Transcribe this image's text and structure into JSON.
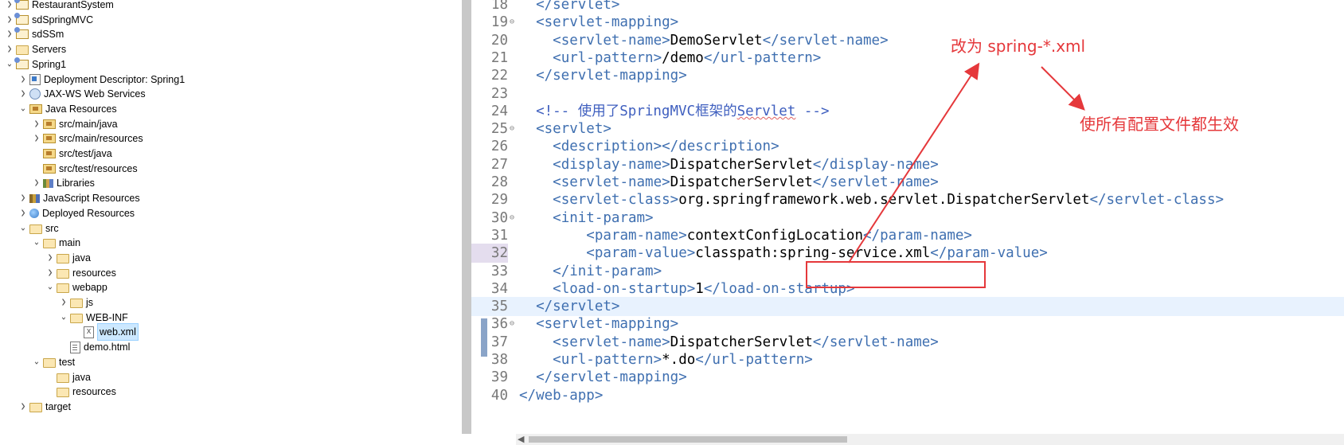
{
  "tree": {
    "items": [
      {
        "label": "RestaurantSystem",
        "chev": ">",
        "icon": "project",
        "depth": 0
      },
      {
        "label": "sdSpringMVC",
        "chev": ">",
        "icon": "project",
        "depth": 0
      },
      {
        "label": "sdSSm",
        "chev": ">",
        "icon": "project",
        "depth": 0
      },
      {
        "label": "Servers",
        "chev": ">",
        "icon": "folder",
        "depth": 0
      },
      {
        "label": "Spring1",
        "chev": "v",
        "icon": "project",
        "depth": 0
      },
      {
        "label": "Deployment Descriptor: Spring1",
        "chev": ">",
        "icon": "desc",
        "depth": 1
      },
      {
        "label": "JAX-WS Web Services",
        "chev": ">",
        "icon": "ws",
        "depth": 1
      },
      {
        "label": "Java Resources",
        "chev": "v",
        "icon": "pkg",
        "depth": 1
      },
      {
        "label": "src/main/java",
        "chev": ">",
        "icon": "pkg",
        "depth": 2
      },
      {
        "label": "src/main/resources",
        "chev": ">",
        "icon": "pkg",
        "depth": 2
      },
      {
        "label": "src/test/java",
        "chev": "",
        "icon": "pkg",
        "depth": 2
      },
      {
        "label": "src/test/resources",
        "chev": "",
        "icon": "pkg",
        "depth": 2
      },
      {
        "label": "Libraries",
        "chev": ">",
        "icon": "lib",
        "depth": 2
      },
      {
        "label": "JavaScript Resources",
        "chev": ">",
        "icon": "jsres",
        "depth": 1
      },
      {
        "label": "Deployed Resources",
        "chev": ">",
        "icon": "globe",
        "depth": 1
      },
      {
        "label": "src",
        "chev": "v",
        "icon": "folder",
        "depth": 1
      },
      {
        "label": "main",
        "chev": "v",
        "icon": "folder",
        "depth": 2
      },
      {
        "label": "java",
        "chev": ">",
        "icon": "folder",
        "depth": 3
      },
      {
        "label": "resources",
        "chev": ">",
        "icon": "folder",
        "depth": 3
      },
      {
        "label": "webapp",
        "chev": "v",
        "icon": "folder",
        "depth": 3
      },
      {
        "label": "js",
        "chev": ">",
        "icon": "folder",
        "depth": 4
      },
      {
        "label": "WEB-INF",
        "chev": "v",
        "icon": "folder",
        "depth": 4
      },
      {
        "label": "web.xml",
        "chev": "",
        "icon": "xml",
        "depth": 5,
        "selected": true
      },
      {
        "label": "demo.html",
        "chev": "",
        "icon": "html",
        "depth": 4
      },
      {
        "label": "test",
        "chev": "v",
        "icon": "folder",
        "depth": 2
      },
      {
        "label": "java",
        "chev": "",
        "icon": "folder",
        "depth": 3
      },
      {
        "label": "resources",
        "chev": "",
        "icon": "folder",
        "depth": 3
      },
      {
        "label": "target",
        "chev": ">",
        "icon": "folder",
        "depth": 1
      }
    ]
  },
  "editor": {
    "lines": [
      {
        "num": "18",
        "indent": "  ",
        "parts": [
          [
            "tag",
            "</servlet>"
          ]
        ]
      },
      {
        "num": "19",
        "fold": true,
        "indent": "  ",
        "parts": [
          [
            "tag",
            "<servlet-mapping>"
          ]
        ]
      },
      {
        "num": "20",
        "indent": "    ",
        "parts": [
          [
            "tag",
            "<servlet-name>"
          ],
          [
            "txt",
            "DemoServlet"
          ],
          [
            "tag",
            "</servlet-name>"
          ]
        ]
      },
      {
        "num": "21",
        "indent": "    ",
        "parts": [
          [
            "tag",
            "<url-pattern>"
          ],
          [
            "txt",
            "/demo"
          ],
          [
            "tag",
            "</url-pattern>"
          ]
        ]
      },
      {
        "num": "22",
        "indent": "  ",
        "parts": [
          [
            "tag",
            "</servlet-mapping>"
          ]
        ]
      },
      {
        "num": "23",
        "indent": "",
        "parts": []
      },
      {
        "num": "24",
        "indent": "  ",
        "parts": [
          [
            "cmt",
            "<!-- 使用了SpringMVC框架的"
          ],
          [
            "cmtsq",
            "Servlet"
          ],
          [
            "cmt",
            " -->"
          ]
        ]
      },
      {
        "num": "25",
        "fold": true,
        "indent": "  ",
        "parts": [
          [
            "tag",
            "<servlet>"
          ]
        ]
      },
      {
        "num": "26",
        "indent": "    ",
        "parts": [
          [
            "tag",
            "<description></description>"
          ]
        ]
      },
      {
        "num": "27",
        "indent": "    ",
        "parts": [
          [
            "tag",
            "<display-name>"
          ],
          [
            "txt",
            "DispatcherServlet"
          ],
          [
            "tag",
            "</display-name>"
          ]
        ]
      },
      {
        "num": "28",
        "indent": "    ",
        "parts": [
          [
            "tag",
            "<servlet-name>"
          ],
          [
            "txt",
            "DispatcherServlet"
          ],
          [
            "tag",
            "</servlet-name>"
          ]
        ]
      },
      {
        "num": "29",
        "indent": "    ",
        "parts": [
          [
            "tag",
            "<servlet-class>"
          ],
          [
            "txt",
            "org.springframework.web.servlet.DispatcherServlet"
          ],
          [
            "tag",
            "</servlet-class>"
          ]
        ]
      },
      {
        "num": "30",
        "fold": true,
        "indent": "    ",
        "parts": [
          [
            "tag",
            "<init-param>"
          ]
        ]
      },
      {
        "num": "31",
        "indent": "        ",
        "parts": [
          [
            "tag",
            "<param-name>"
          ],
          [
            "txt",
            "contextConfigLocation"
          ],
          [
            "tag",
            "</param-name>"
          ]
        ]
      },
      {
        "num": "32",
        "active": true,
        "indent": "        ",
        "parts": [
          [
            "tag",
            "<param-value>"
          ],
          [
            "txt",
            "classpath:spring-service.xml"
          ],
          [
            "tag",
            "</param-value>"
          ]
        ]
      },
      {
        "num": "33",
        "indent": "    ",
        "parts": [
          [
            "tag",
            "</init-param>"
          ]
        ]
      },
      {
        "num": "34",
        "indent": "    ",
        "parts": [
          [
            "tag",
            "<load-on-startup>"
          ],
          [
            "txt",
            "1"
          ],
          [
            "tag",
            "</load-on-startup>"
          ]
        ]
      },
      {
        "num": "35",
        "current": true,
        "indent": "  ",
        "parts": [
          [
            "tag",
            "</servlet>"
          ]
        ]
      },
      {
        "num": "36",
        "fold": true,
        "indent": "  ",
        "parts": [
          [
            "tag",
            "<servlet-mapping>"
          ]
        ]
      },
      {
        "num": "37",
        "indent": "    ",
        "parts": [
          [
            "tag",
            "<servlet-name>"
          ],
          [
            "txt",
            "DispatcherServlet"
          ],
          [
            "tag",
            "</servlet-name>"
          ]
        ]
      },
      {
        "num": "38",
        "indent": "    ",
        "parts": [
          [
            "tag",
            "<url-pattern>"
          ],
          [
            "txt",
            "*.do"
          ],
          [
            "tag",
            "</url-pattern>"
          ]
        ]
      },
      {
        "num": "39",
        "indent": "  ",
        "parts": [
          [
            "tag",
            "</servlet-mapping>"
          ]
        ]
      },
      {
        "num": "40",
        "indent": "",
        "parts": [
          [
            "tag",
            "</web-app>"
          ]
        ]
      }
    ]
  },
  "annotations": {
    "change_note": "改为 spring-*.xml",
    "effect_note": "使所有配置文件都生效"
  },
  "colors": {
    "annotation_red": "#e5383b",
    "tag_blue": "#3f6fb0",
    "comment_blue": "#3f5fbf",
    "selection": "#cce8ff"
  }
}
